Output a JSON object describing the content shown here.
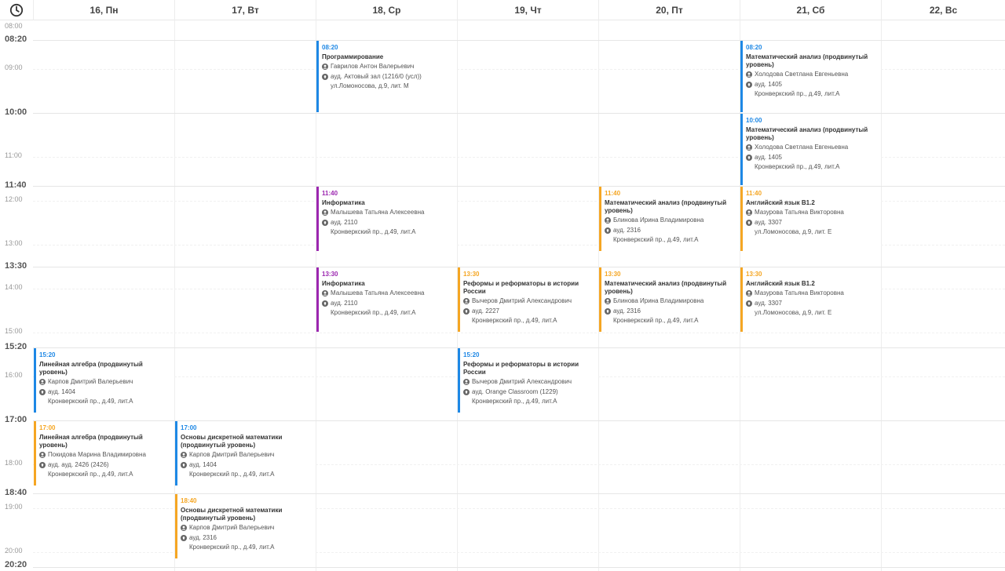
{
  "header": {
    "clock_icon": "clock-icon",
    "days": [
      "16, Пн",
      "17, Вт",
      "18, Ср",
      "19, Чт",
      "20, Пт",
      "21, Сб",
      "22, Вс"
    ]
  },
  "time_axis": [
    {
      "label": "08:00",
      "kind": "minor"
    },
    {
      "label": "08:20",
      "kind": "major"
    },
    {
      "label": "09:00",
      "kind": "minor"
    },
    {
      "label": "10:00",
      "kind": "major"
    },
    {
      "label": "11:00",
      "kind": "minor"
    },
    {
      "label": "11:40",
      "kind": "major"
    },
    {
      "label": "12:00",
      "kind": "minor"
    },
    {
      "label": "13:00",
      "kind": "minor"
    },
    {
      "label": "13:30",
      "kind": "major"
    },
    {
      "label": "14:00",
      "kind": "minor"
    },
    {
      "label": "15:00",
      "kind": "minor"
    },
    {
      "label": "15:20",
      "kind": "major"
    },
    {
      "label": "16:00",
      "kind": "minor"
    },
    {
      "label": "17:00",
      "kind": "major"
    },
    {
      "label": "18:00",
      "kind": "minor"
    },
    {
      "label": "18:40",
      "kind": "major"
    },
    {
      "label": "19:00",
      "kind": "minor"
    },
    {
      "label": "20:00",
      "kind": "minor"
    },
    {
      "label": "20:20",
      "kind": "major"
    }
  ],
  "colors": {
    "blue": "#1e88e5",
    "orange": "#f5a623",
    "purple": "#9c27b0"
  },
  "events": [
    {
      "day": 2,
      "start": "08:20",
      "end": "10:00",
      "color": "blue",
      "time": "08:20",
      "title": "Программирование",
      "teacher": "Гаврилов Антон Валерьевич",
      "room": "ауд. Актовый зал (1216/0 (усл))",
      "address": "ул.Ломоносова, д.9, лит. М"
    },
    {
      "day": 5,
      "start": "08:20",
      "end": "10:00",
      "color": "blue",
      "time": "08:20",
      "title": "Математический анализ (продвинутый уровень)",
      "teacher": "Холодова Светлана Евгеньевна",
      "room": "ауд. 1405",
      "address": "Кронверкский пр., д.49, лит.А"
    },
    {
      "day": 5,
      "start": "10:00",
      "end": "11:40",
      "color": "blue",
      "time": "10:00",
      "title": "Математический анализ (продвинутый уровень)",
      "teacher": "Холодова Светлана Евгеньевна",
      "room": "ауд. 1405",
      "address": "Кронверкский пр., д.49, лит.А"
    },
    {
      "day": 2,
      "start": "11:40",
      "end": "13:10",
      "color": "purple",
      "time": "11:40",
      "title": "Информатика",
      "teacher": "Малышева Татьяна Алексеевна",
      "room": "ауд. 2110",
      "address": "Кронверкский пр., д.49, лит.А"
    },
    {
      "day": 4,
      "start": "11:40",
      "end": "13:10",
      "color": "orange",
      "time": "11:40",
      "title": "Математический анализ (продвинутый уровень)",
      "teacher": "Блинова Ирина Владимировна",
      "room": "ауд. 2316",
      "address": "Кронверкский пр., д.49, лит.А"
    },
    {
      "day": 5,
      "start": "11:40",
      "end": "13:10",
      "color": "orange",
      "time": "11:40",
      "title": "Английский язык B1.2",
      "teacher": "Мазурова Татьяна Викторовна",
      "room": "ауд. 3307",
      "address": "ул.Ломоносова, д.9, лит. Е"
    },
    {
      "day": 2,
      "start": "13:30",
      "end": "15:00",
      "color": "purple",
      "time": "13:30",
      "title": "Информатика",
      "teacher": "Малышева Татьяна Алексеевна",
      "room": "ауд. 2110",
      "address": "Кронверкский пр., д.49, лит.А"
    },
    {
      "day": 3,
      "start": "13:30",
      "end": "15:00",
      "color": "orange",
      "time": "13:30",
      "title": "Реформы и реформаторы в истории России",
      "teacher": "Вычеров Дмитрий Александрович",
      "room": "ауд. 2227",
      "address": "Кронверкский пр., д.49, лит.А"
    },
    {
      "day": 4,
      "start": "13:30",
      "end": "15:00",
      "color": "orange",
      "time": "13:30",
      "title": "Математический анализ (продвинутый уровень)",
      "teacher": "Блинова Ирина Владимировна",
      "room": "ауд. 2316",
      "address": "Кронверкский пр., д.49, лит.А"
    },
    {
      "day": 5,
      "start": "13:30",
      "end": "15:00",
      "color": "orange",
      "time": "13:30",
      "title": "Английский язык B1.2",
      "teacher": "Мазурова Татьяна Викторовна",
      "room": "ауд. 3307",
      "address": "ул.Ломоносова, д.9, лит. Е"
    },
    {
      "day": 0,
      "start": "15:20",
      "end": "16:50",
      "color": "blue",
      "time": "15:20",
      "title": "Линейная алгебра (продвинутый уровень)",
      "teacher": "Карпов Дмитрий Валерьевич",
      "room": "ауд. 1404",
      "address": "Кронверкский пр., д.49, лит.А"
    },
    {
      "day": 3,
      "start": "15:20",
      "end": "16:50",
      "color": "blue",
      "time": "15:20",
      "title": "Реформы и реформаторы в истории России",
      "teacher": "Вычеров Дмитрий Александрович",
      "room": "ауд. Orange Classroom (1229)",
      "address": "Кронверкский пр., д.49, лит.А"
    },
    {
      "day": 0,
      "start": "17:00",
      "end": "18:30",
      "color": "orange",
      "time": "17:00",
      "title": "Линейная алгебра (продвинутый уровень)",
      "teacher": "Покидова Марина Владимировна",
      "room": "ауд. ауд. 2426 (2426)",
      "address": "Кронверкский пр., д.49, лит.А"
    },
    {
      "day": 1,
      "start": "17:00",
      "end": "18:30",
      "color": "blue",
      "time": "17:00",
      "title": "Основы дискретной математики (продвинутый уровень)",
      "teacher": "Карпов Дмитрий Валерьевич",
      "room": "ауд. 1404",
      "address": "Кронверкский пр., д.49, лит.А"
    },
    {
      "day": 1,
      "start": "18:40",
      "end": "20:10",
      "color": "orange",
      "time": "18:40",
      "title": "Основы дискретной математики (продвинутый уровень)",
      "teacher": "Карпов Дмитрий Валерьевич",
      "room": "ауд. 2316",
      "address": "Кронверкский пр., д.49, лит.А"
    }
  ]
}
